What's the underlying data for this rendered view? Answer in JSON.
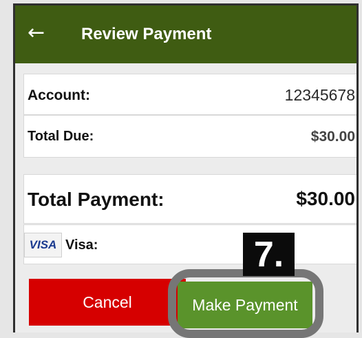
{
  "header": {
    "back_icon": "←",
    "title": "Review Payment"
  },
  "rows": {
    "account": {
      "label": "Account:",
      "value": "12345678"
    },
    "total_due": {
      "label": "Total Due:",
      "value": "$30.00"
    },
    "total_payment": {
      "label": "Total Payment:",
      "value": "$30.00"
    },
    "payment_method": {
      "card_logo": "VISA",
      "label": "Visa:"
    }
  },
  "buttons": {
    "cancel": "Cancel",
    "make_payment": "Make Payment"
  },
  "annotation": {
    "step": "7."
  },
  "colors": {
    "header_bg": "#3f5c12",
    "cancel_bg": "#d60000",
    "pay_bg": "#5a932b",
    "highlight_ring": "#767676"
  }
}
